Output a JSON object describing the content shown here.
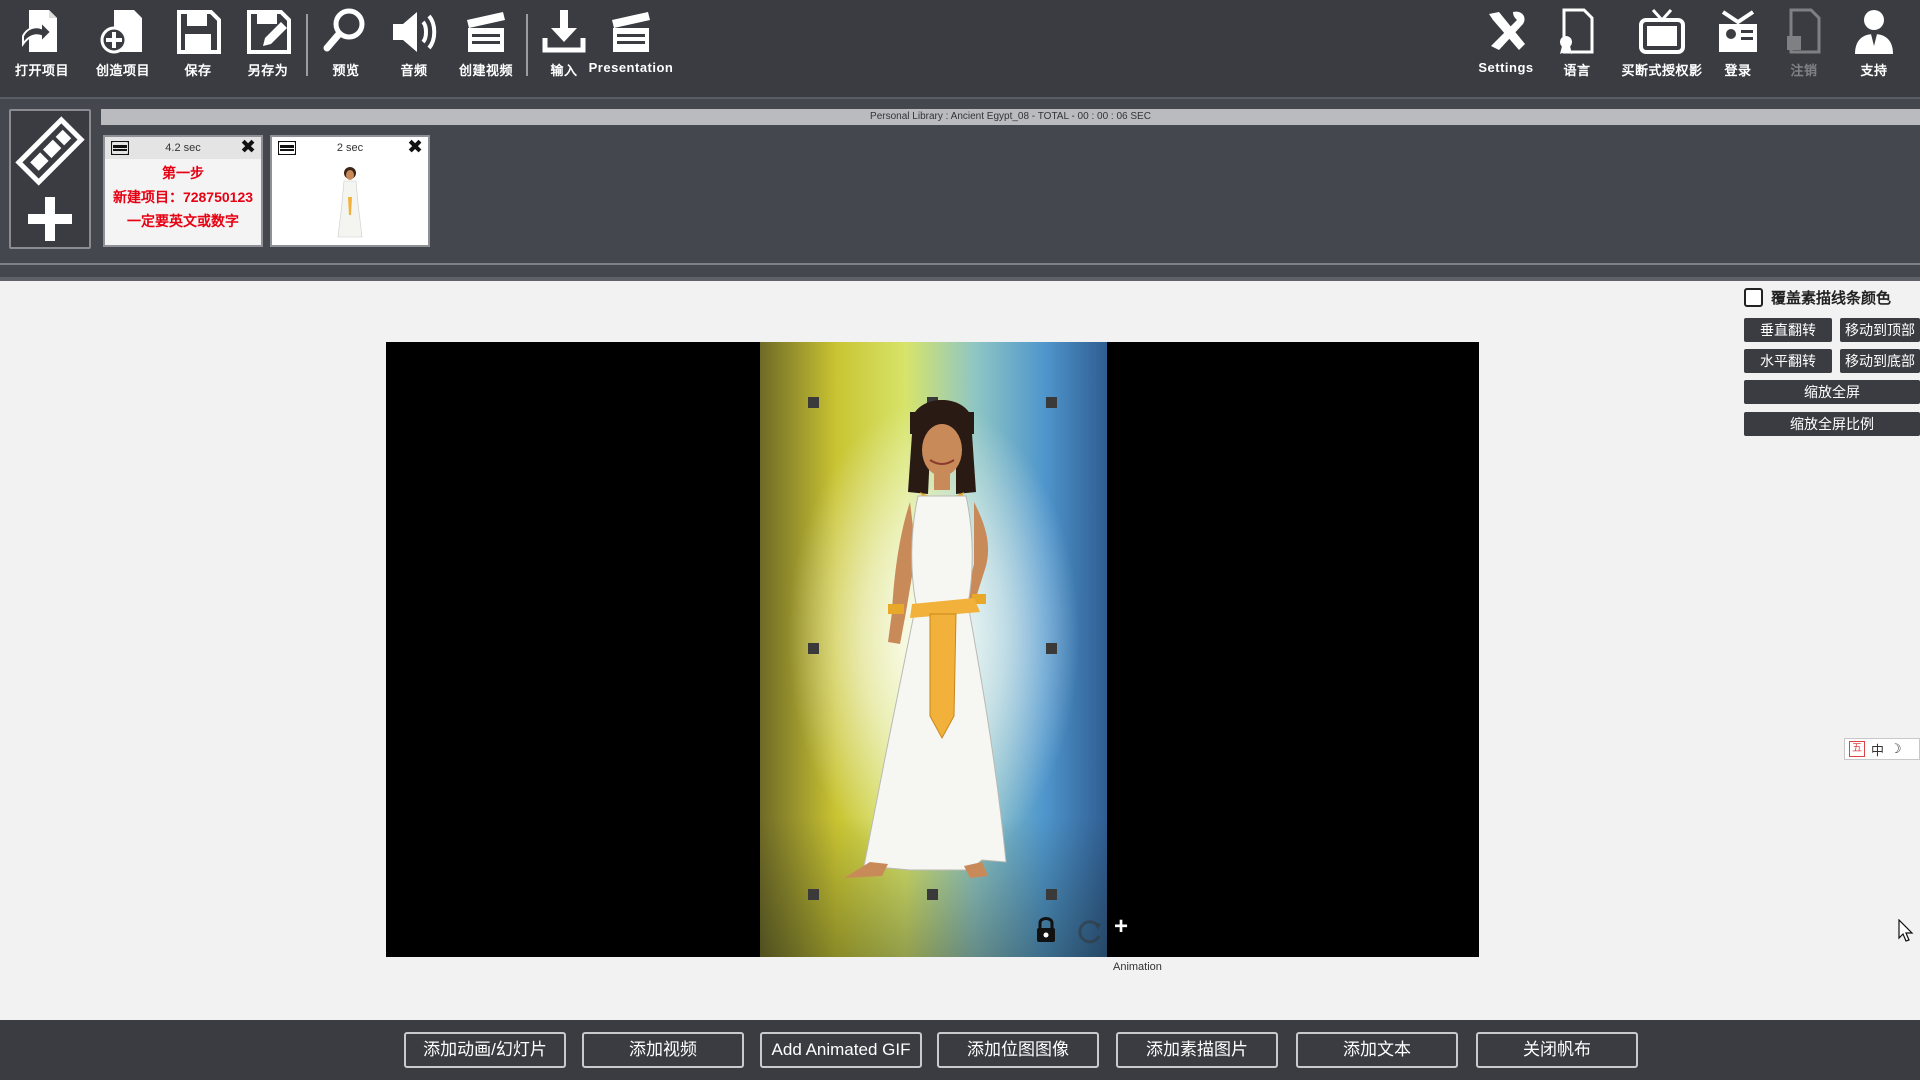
{
  "toolbar": {
    "left": [
      {
        "label": "打开项目",
        "icon": "open-project-icon"
      },
      {
        "label": "创造项目",
        "icon": "create-project-icon"
      },
      {
        "label": "保存",
        "icon": "save-icon"
      },
      {
        "label": "另存为",
        "icon": "save-as-icon"
      },
      {
        "label": "预览",
        "icon": "preview-icon"
      },
      {
        "label": "音频",
        "icon": "audio-icon"
      },
      {
        "label": "创建视频",
        "icon": "create-video-icon"
      },
      {
        "label": "输入",
        "icon": "import-icon"
      },
      {
        "label": "Presentation",
        "icon": "presentation-icon"
      }
    ],
    "right": [
      {
        "label": "Settings",
        "icon": "settings-icon"
      },
      {
        "label": "语言",
        "icon": "language-icon"
      },
      {
        "label": "买断式授权影",
        "icon": "tv-license-icon"
      },
      {
        "label": "登录",
        "icon": "login-icon"
      },
      {
        "label": "注销",
        "icon": "logout-icon"
      },
      {
        "label": "支持",
        "icon": "support-icon"
      }
    ]
  },
  "library_bar": "Personal Library : Ancient Egypt_08  -  TOTAL - 00 : 00 : 06 SEC",
  "slides": [
    {
      "duration": "4.2 sec",
      "lines": [
        "第一步",
        "新建项目：728750123",
        "一定要英文或数字"
      ]
    },
    {
      "duration": "2 sec"
    }
  ],
  "canvas": {
    "animation_label": "Animation"
  },
  "right_panel": {
    "overlay_checkbox_label": "覆盖素描线条颜色",
    "overlay_checked": false,
    "buttons": {
      "flip_vertical": "垂直翻转",
      "move_to_top": "移动到顶部",
      "flip_horizontal": "水平翻转",
      "move_to_bottom": "移动到底部",
      "fit_fullscreen": "缩放全屏",
      "fit_fullscreen_ratio": "缩放全屏比例"
    },
    "ime": {
      "box": "五",
      "lang": "中"
    }
  },
  "bottom_bar": [
    "添加动画/幻灯片",
    "添加视频",
    "Add Animated GIF",
    "添加位图图像",
    "添加素描图片",
    "添加文本",
    "关闭帆布"
  ],
  "colors": {
    "toolbar_bg": "#3a3c42",
    "strip_bg": "#45474e",
    "slide_red_text": "#e60012"
  }
}
